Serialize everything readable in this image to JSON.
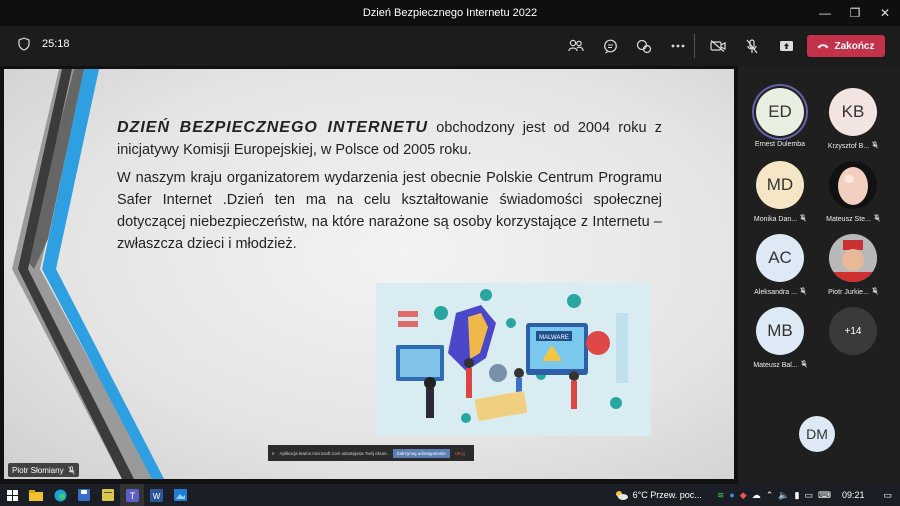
{
  "window": {
    "title": "Dzień Bezpiecznego Internetu 2022"
  },
  "toolbar": {
    "timer": "25:18",
    "end_label": "Zakończ"
  },
  "slide": {
    "heading": "DZIEŃ BEZPIECZNEGO INTERNETU",
    "para1_rest": " obchodzony jest od 2004 roku z inicjatywy Komisji Europejskiej, w Polsce od 2005 roku.",
    "para2": "W naszym kraju organizatorem wydarzenia jest obecnie Polskie Centrum Programu Safer Internet .Dzień ten ma na celu kształtowanie świadomości społecznej dotyczącej niebezpieczeństw, na które narażone są osoby korzystające z Internetu – zwłaszcza dzieci i młodzież.",
    "malware_label": "MALWARE"
  },
  "share_banner": {
    "text": "Aplikacja teams.microsoft.com udostępnia Twój ekran.",
    "stop_label": "Zatrzymaj udostępnianie",
    "hide_label": "Ukryj"
  },
  "presenter": {
    "name": "Piotr Słomiany"
  },
  "participants": [
    {
      "initials": "ED",
      "name": "Ernest Dulemba",
      "color": "#e8eee0",
      "muted": false,
      "selected": true
    },
    {
      "initials": "KB",
      "name": "Krzysztof B...",
      "color": "#f2e4e0",
      "muted": true
    },
    {
      "initials": "MD",
      "name": "Monika Dan...",
      "color": "#f5e6c6",
      "muted": true
    },
    {
      "initials": "",
      "name": "Mateusz Ste...",
      "color": "#111111",
      "muted": true
    },
    {
      "initials": "AC",
      "name": "Aleksandra ...",
      "color": "#dde9f5",
      "muted": true
    },
    {
      "initials": "",
      "name": "Piotr Jurkie...",
      "color": "#a0a0a0",
      "muted": true
    },
    {
      "initials": "MB",
      "name": "Mateusz Bal...",
      "color": "#dde9f5",
      "muted": true
    }
  ],
  "more_participants": "+14",
  "self_view": {
    "initials": "DM"
  },
  "taskbar": {
    "weather": "6°C Przew. poc...",
    "time": "09:21"
  }
}
